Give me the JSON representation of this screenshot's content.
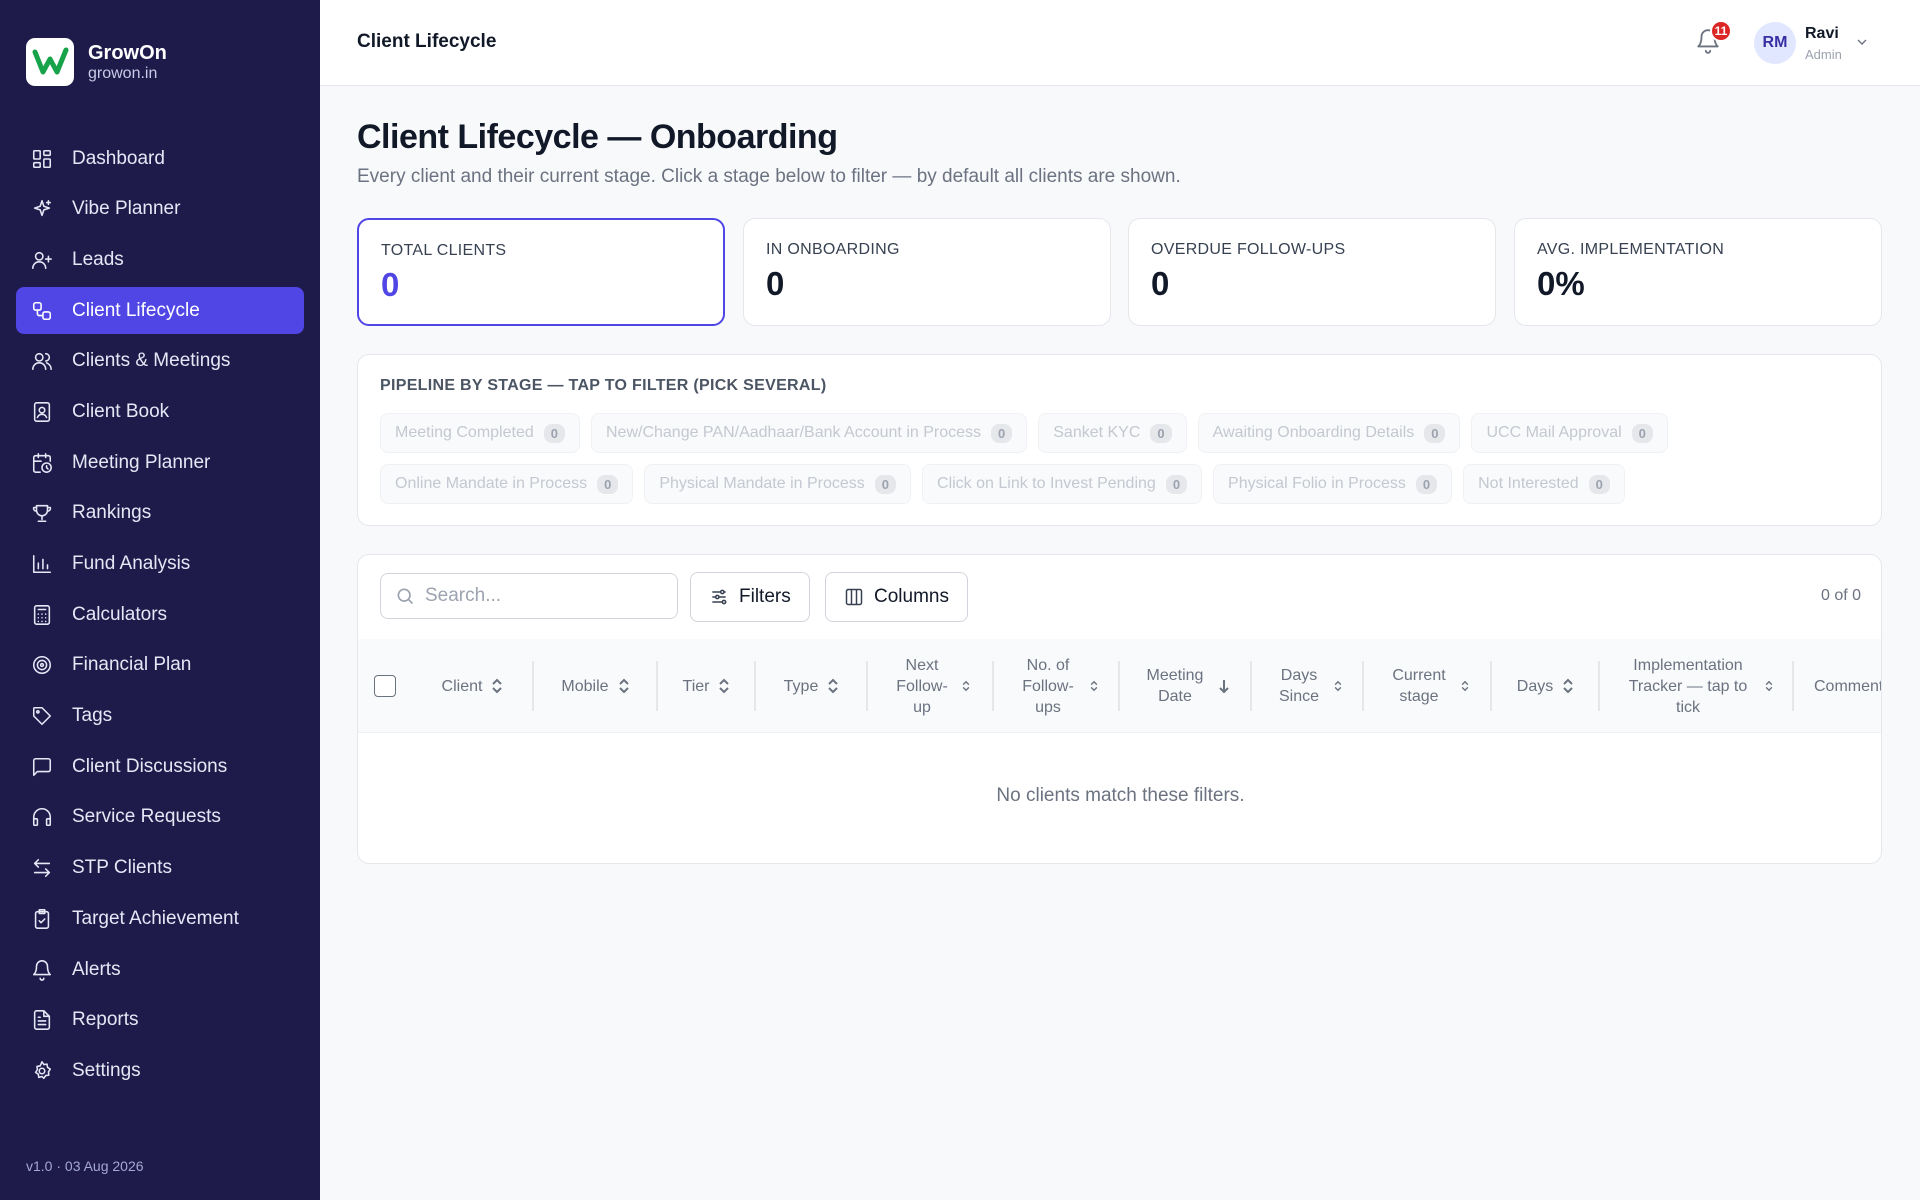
{
  "brand": {
    "name": "GrowOn",
    "url": "growon.in"
  },
  "sidebar": {
    "items": [
      {
        "label": "Dashboard",
        "icon": "dashboard-icon"
      },
      {
        "label": "Vibe Planner",
        "icon": "sparkle-icon"
      },
      {
        "label": "Leads",
        "icon": "user-plus-icon"
      },
      {
        "label": "Client Lifecycle",
        "icon": "workflow-icon",
        "active": true
      },
      {
        "label": "Clients & Meetings",
        "icon": "users-icon"
      },
      {
        "label": "Client Book",
        "icon": "contact-book-icon"
      },
      {
        "label": "Meeting Planner",
        "icon": "calendar-clock-icon"
      },
      {
        "label": "Rankings",
        "icon": "trophy-icon"
      },
      {
        "label": "Fund Analysis",
        "icon": "bar-chart-icon"
      },
      {
        "label": "Calculators",
        "icon": "calculator-icon"
      },
      {
        "label": "Financial Plan",
        "icon": "target-icon"
      },
      {
        "label": "Tags",
        "icon": "tag-icon"
      },
      {
        "label": "Client Discussions",
        "icon": "message-icon"
      },
      {
        "label": "Service Requests",
        "icon": "headset-icon"
      },
      {
        "label": "STP Clients",
        "icon": "transfer-icon"
      },
      {
        "label": "Target Achievement",
        "icon": "clipboard-check-icon"
      },
      {
        "label": "Alerts",
        "icon": "bell-icon"
      },
      {
        "label": "Reports",
        "icon": "report-icon"
      },
      {
        "label": "Settings",
        "icon": "gear-icon"
      }
    ],
    "version": "v1.0 · 03 Aug 2026"
  },
  "topbar": {
    "title": "Client Lifecycle",
    "notifications": "11",
    "user": {
      "initials": "RM",
      "name": "Ravi",
      "role": "Admin"
    }
  },
  "main": {
    "title": "Client Lifecycle — Onboarding",
    "subtitle": "Every client and their current stage. Click a stage below to filter — by default all clients are shown.",
    "stats": [
      {
        "label": "TOTAL CLIENTS",
        "value": "0",
        "active": true
      },
      {
        "label": "IN ONBOARDING",
        "value": "0"
      },
      {
        "label": "OVERDUE FOLLOW-UPS",
        "value": "0"
      },
      {
        "label": "AVG. IMPLEMENTATION",
        "value": "0%"
      }
    ],
    "pipeline": {
      "title": "PIPELINE BY STAGE — TAP TO FILTER (PICK SEVERAL)",
      "stages": [
        {
          "label": "Meeting Completed",
          "count": "0"
        },
        {
          "label": "New/Change PAN/Aadhaar/Bank Account in Process",
          "count": "0"
        },
        {
          "label": "Sanket KYC",
          "count": "0"
        },
        {
          "label": "Awaiting Onboarding Details",
          "count": "0"
        },
        {
          "label": "UCC Mail Approval",
          "count": "0"
        },
        {
          "label": "Online Mandate in Process",
          "count": "0"
        },
        {
          "label": "Physical Mandate in Process",
          "count": "0"
        },
        {
          "label": "Click on Link to Invest Pending",
          "count": "0"
        },
        {
          "label": "Physical Folio in Process",
          "count": "0"
        },
        {
          "label": "Not Interested",
          "count": "0"
        }
      ]
    },
    "table": {
      "search_placeholder": "Search...",
      "filters_label": "Filters",
      "columns_label": "Columns",
      "row_count": "0 of 0",
      "columns": [
        "Client",
        "Mobile",
        "Tier",
        "Type",
        "Next Follow-up",
        "No. of Follow-ups",
        "Meeting Date",
        "Days Since",
        "Current stage",
        "Days",
        "Implementation Tracker — tap to tick",
        "Comment"
      ],
      "empty_message": "No clients match these filters."
    }
  }
}
